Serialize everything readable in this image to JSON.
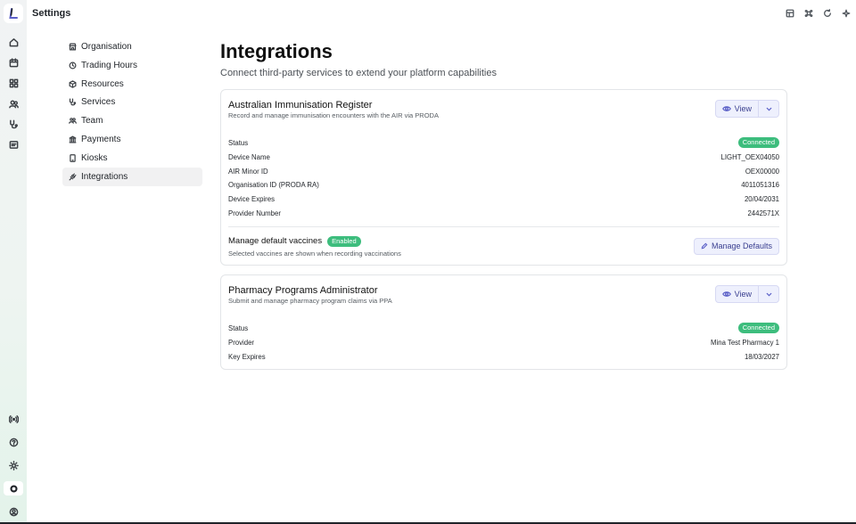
{
  "app": {
    "title": "Settings"
  },
  "rail": {
    "icons": [
      "home-icon",
      "calendar-icon",
      "grid-icon",
      "users-icon",
      "stethoscope-icon",
      "inbox-icon",
      "broadcast-icon",
      "help-icon",
      "sun-icon",
      "gear-icon",
      "user-circle-icon"
    ]
  },
  "nav": {
    "items": [
      {
        "label": "Organisation",
        "icon": "store-icon"
      },
      {
        "label": "Trading Hours",
        "icon": "clock-icon"
      },
      {
        "label": "Resources",
        "icon": "box-icon"
      },
      {
        "label": "Services",
        "icon": "stethoscope-icon"
      },
      {
        "label": "Team",
        "icon": "team-icon"
      },
      {
        "label": "Payments",
        "icon": "bank-icon"
      },
      {
        "label": "Kiosks",
        "icon": "tablet-icon"
      },
      {
        "label": "Integrations",
        "icon": "plug-icon"
      }
    ],
    "active": "Integrations"
  },
  "page": {
    "title": "Integrations",
    "subtitle": "Connect third-party services to extend your platform capabilities"
  },
  "air": {
    "title": "Australian Immunisation Register",
    "description": "Record and manage immunisation encounters with the AIR via PRODA",
    "view_label": "View",
    "status_label": "Status",
    "status_value": "Connected",
    "rows": [
      {
        "label": "Device Name",
        "value": "LIGHT_OEX04050"
      },
      {
        "label": "AIR Minor ID",
        "value": "OEX00000"
      },
      {
        "label": "Organisation ID (PRODA RA)",
        "value": "4011051316"
      },
      {
        "label": "Device Expires",
        "value": "20/04/2031"
      },
      {
        "label": "Provider Number",
        "value": "2442571X"
      }
    ],
    "defaults_title": "Manage default vaccines",
    "defaults_badge": "Enabled",
    "defaults_desc": "Selected vaccines are shown when recording vaccinations",
    "manage_label": "Manage Defaults"
  },
  "ppa": {
    "title": "Pharmacy Programs Administrator",
    "description": "Submit and manage pharmacy program claims via PPA",
    "view_label": "View",
    "status_label": "Status",
    "status_value": "Connected",
    "rows": [
      {
        "label": "Provider",
        "value": "Mina Test Pharmacy 1"
      },
      {
        "label": "Key Expires",
        "value": "18/03/2027"
      }
    ]
  },
  "colors": {
    "accent": "#5a5fc7",
    "success": "#3dbd7d"
  }
}
